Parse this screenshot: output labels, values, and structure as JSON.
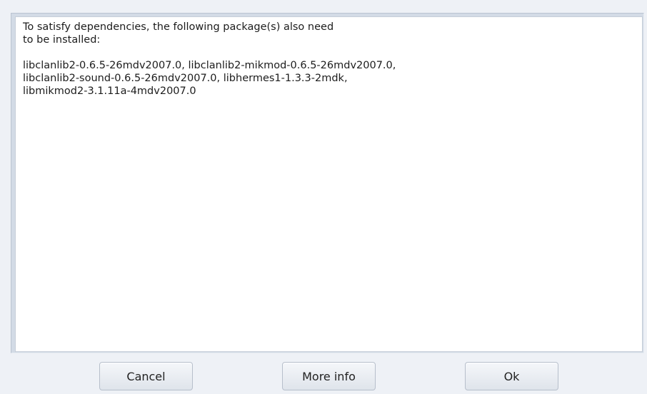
{
  "message": {
    "intro_line1": "To satisfy dependencies, the following package(s) also need",
    "intro_line2": "to be installed:",
    "packages_line1": "libclanlib2-0.6.5-26mdv2007.0, libclanlib2-mikmod-0.6.5-26mdv2007.0,",
    "packages_line2": "libclanlib2-sound-0.6.5-26mdv2007.0, libhermes1-1.3.3-2mdk,",
    "packages_line3": "libmikmod2-3.1.11a-4mdv2007.0"
  },
  "buttons": {
    "cancel": "Cancel",
    "more_info": "More info",
    "ok": "Ok"
  }
}
